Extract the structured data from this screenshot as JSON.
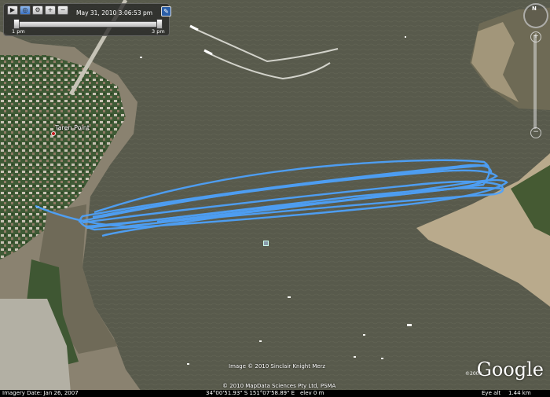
{
  "timeslider": {
    "datetime": "May 31, 2010   3:06:53 pm",
    "start_label": "1 pm",
    "end_label": "3 pm"
  },
  "compass": {
    "north": "N"
  },
  "place": {
    "name": "Taren Point"
  },
  "attribution": {
    "image_credit": "Image © 2010 Sinclair Knight Merz",
    "data_credit": "© 2010 MapData Sciences Pty Ltd, PSMA",
    "google_year": "©2009",
    "logo": "Google"
  },
  "statusbar": {
    "imagery_date": "Imagery Date: Jan 26, 2007",
    "coordinates": "34°00'51.93\" S   151°07'58.89\" E",
    "elev": "elev  0 m",
    "eye_alt_label": "Eye alt",
    "eye_alt_value": "1.44 km"
  },
  "colors": {
    "water": "#585a4c",
    "track": "#4da3ff",
    "land": "#8a8270",
    "sand": "#b9aa8c"
  },
  "icons": [
    "play-icon",
    "globe-icon",
    "zoom-in-icon",
    "zoom-out-icon",
    "wrench-icon",
    "compass-icon"
  ]
}
